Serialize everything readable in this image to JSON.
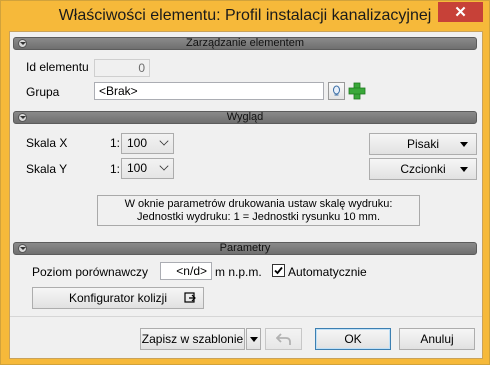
{
  "window": {
    "title": "Właściwości elementu: Profil instalacji kanalizacyjnej",
    "close_symbol": "✕"
  },
  "sections": {
    "management": "Zarządzanie elementem",
    "appearance": "Wygląd",
    "parameters": "Parametry"
  },
  "management": {
    "id_label": "Id elementu",
    "id_value": "0",
    "group_label": "Grupa",
    "group_value": "<Brak>"
  },
  "appearance": {
    "scale_x_label": "Skala X",
    "scale_x_prefix": "1:",
    "scale_x_value": "100",
    "scale_y_label": "Skala Y",
    "scale_y_prefix": "1:",
    "scale_y_value": "100",
    "pens_button": "Pisaki",
    "fonts_button": "Czcionki",
    "info_line1": "W oknie parametrów drukowania ustaw skalę wydruku:",
    "info_line2": "Jednostki wydruku: 1 = Jednostki rysunku 10 mm."
  },
  "parameters": {
    "level_label": "Poziom porównawczy",
    "level_value": "<n/d>",
    "level_unit": "m n.p.m.",
    "auto_checked": true,
    "auto_label": "Automatycznie",
    "configurator_button": "Konfigurator kolizji"
  },
  "footer": {
    "save_template": "Zapisz w szablonie",
    "ok": "OK",
    "cancel": "Anuluj"
  },
  "colors": {
    "title_bar": "#f6b93a",
    "close_button": "#c74138",
    "plus_icon": "#3aa83a"
  }
}
